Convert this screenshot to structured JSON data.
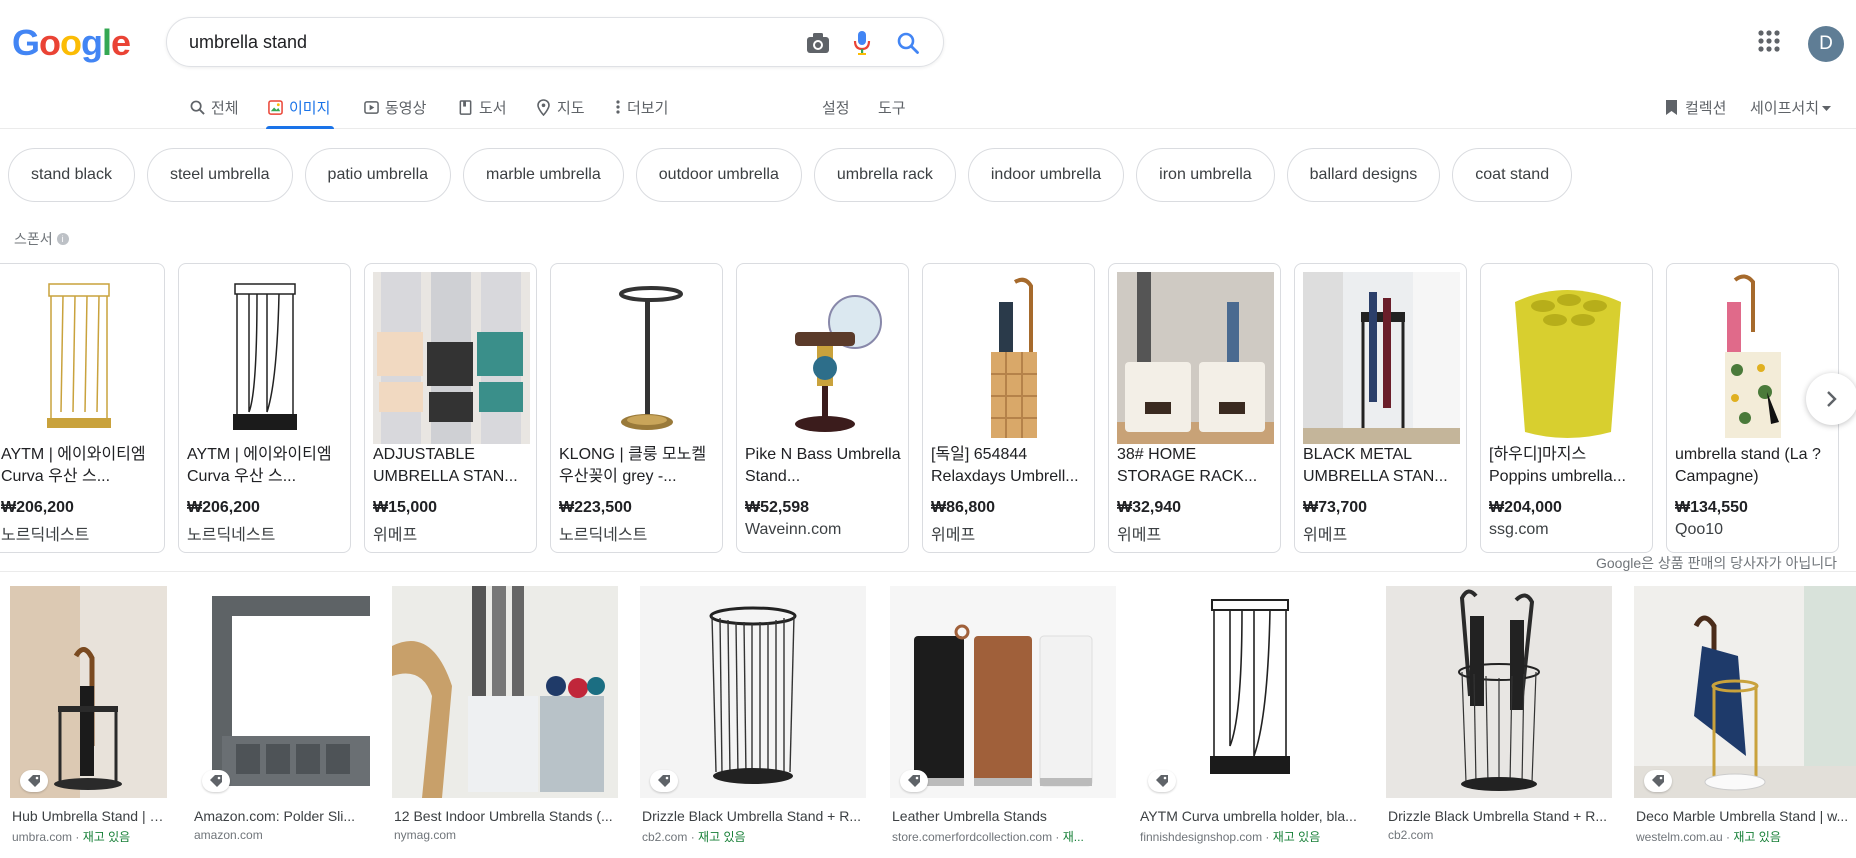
{
  "logo": {
    "letters": [
      "G",
      "o",
      "o",
      "g",
      "l",
      "e"
    ],
    "colors": [
      "#4285F4",
      "#EA4335",
      "#FBBC05",
      "#4285F4",
      "#34A853",
      "#EA4335"
    ]
  },
  "search": {
    "query": "umbrella stand"
  },
  "user": {
    "initial": "D",
    "avatar_color": "#5f7d95"
  },
  "tabs": [
    {
      "label": "전체",
      "icon": "search-icon"
    },
    {
      "label": "이미지",
      "icon": "image-icon",
      "active": true
    },
    {
      "label": "동영상",
      "icon": "video-icon"
    },
    {
      "label": "도서",
      "icon": "book-icon"
    },
    {
      "label": "지도",
      "icon": "map-pin-icon"
    },
    {
      "label": "더보기",
      "icon": "more-vertical-icon"
    },
    {
      "label": "설정"
    },
    {
      "label": "도구"
    }
  ],
  "right_tabs": {
    "collections": "컬렉션",
    "safesearch": "세이프서치"
  },
  "chips": [
    "stand black",
    "steel umbrella",
    "patio umbrella",
    "marble umbrella",
    "outdoor umbrella",
    "umbrella rack",
    "indoor umbrella",
    "iron umbrella",
    "ballard designs",
    "coat stand"
  ],
  "sponsor_label": "스폰서",
  "products": [
    {
      "title": "AYTM | 에이와이티엠 Curva 우산 스...",
      "price": "₩206,200",
      "store": "노르딕네스트",
      "thumb": "gold-wire-stand"
    },
    {
      "title": "AYTM | 에이와이티엠 Curva 우산 스...",
      "price": "₩206,200",
      "store": "노르딕네스트",
      "thumb": "black-wire-stand"
    },
    {
      "title": "ADJUSTABLE UMBRELLA STAN...",
      "price": "₩15,000",
      "store": "위메프",
      "thumb": "wall-holders"
    },
    {
      "title": "KLONG | 클룽 모노켈 우산꽂이 grey -...",
      "price": "₩223,500",
      "store": "노르딕네스트",
      "thumb": "ring-stand"
    },
    {
      "title": "Pike N Bass Umbrella Stand...",
      "price": "₩52,598",
      "store": "Waveinn.com",
      "thumb": "fishing-stand"
    },
    {
      "title": "[독일] 654844 Relaxdays Umbrell...",
      "price": "₩86,800",
      "store": "위메프",
      "thumb": "wood-stand"
    },
    {
      "title": "38# HOME STORAGE RACK...",
      "price": "₩32,940",
      "store": "위메프",
      "thumb": "white-boxes"
    },
    {
      "title": "BLACK METAL UMBRELLA STAN...",
      "price": "₩73,700",
      "store": "위메프",
      "thumb": "black-metal-stand"
    },
    {
      "title": "[하우디]마지스 Poppins umbrella...",
      "price": "₩204,000",
      "store": "ssg.com",
      "thumb": "yellow-stand"
    },
    {
      "title": "umbrella stand (La ? Campagne)",
      "price": "₩134,550",
      "store": "Qoo10",
      "thumb": "floral-stand"
    }
  ],
  "disclaimer": "Google은 상품 판매의 당사자가 아닙니다",
  "results": [
    {
      "title": "Hub Umbrella Stand | S...",
      "source": "umbra.com",
      "stock": "재고 있음",
      "thumb": "hub-stand",
      "tag": true
    },
    {
      "title": "Amazon.com: Polder Sli...",
      "source": "amazon.com",
      "stock": "",
      "thumb": "grey-rack",
      "tag": true
    },
    {
      "title": "12 Best Indoor Umbrella Stands (...",
      "source": "nymag.com",
      "stock": "",
      "thumb": "planter-stand",
      "tag": false
    },
    {
      "title": "Drizzle Black Umbrella Stand + R...",
      "source": "cb2.com",
      "stock": "재고 있음",
      "thumb": "drizzle-cylinder",
      "tag": true
    },
    {
      "title": "Leather Umbrella Stands",
      "source": "store.comerfordcollection.com",
      "stock": "재...",
      "thumb": "leather-cylinders",
      "tag": true
    },
    {
      "title": "AYTM Curva umbrella holder, bla...",
      "source": "finnishdesignshop.com",
      "stock": "재고 있음",
      "thumb": "curva-wire",
      "tag": true
    },
    {
      "title": "Drizzle Black Umbrella Stand + R...",
      "source": "cb2.com",
      "stock": "",
      "thumb": "drizzle-umbrellas",
      "tag": false
    },
    {
      "title": "Deco Marble Umbrella Stand | w...",
      "source": "westelm.com.au",
      "stock": "재고 있음",
      "thumb": "marble-stand",
      "tag": true
    }
  ]
}
